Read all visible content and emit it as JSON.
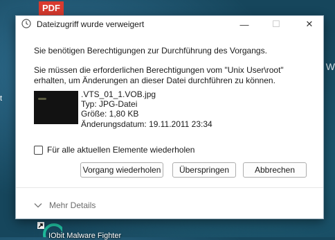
{
  "desktop": {
    "pdf_badge": "PDF",
    "bottom_label": "IObit Malware Fighter"
  },
  "dialog": {
    "title": "Dateizugriff wurde verweigert",
    "controls": {
      "minimize": "—",
      "maximize": "☐",
      "close": "✕"
    },
    "message_permission": "Sie benötigen Berechtigungen zur Durchführung des Vorgangs.",
    "message_required_line1": "Sie müssen die erforderlichen Berechtigungen vom \"Unix User\\root\"",
    "message_required_line2": "erhalten, um Änderungen an dieser Datei durchführen zu können.",
    "file": {
      "name": ".VTS_01_1.VOB.jpg",
      "type": "Typ: JPG-Datei",
      "size": "Größe: 1,80 KB",
      "modified": "Änderungsdatum: 19.11.2011 23:34"
    },
    "repeat_checkbox_label": "Für alle aktuellen Elemente wiederholen",
    "repeat_checked": false,
    "buttons": {
      "retry": "Vorgang wiederholen",
      "skip": "Überspringen",
      "cancel": "Abbrechen"
    },
    "more_details": "Mehr Details"
  }
}
